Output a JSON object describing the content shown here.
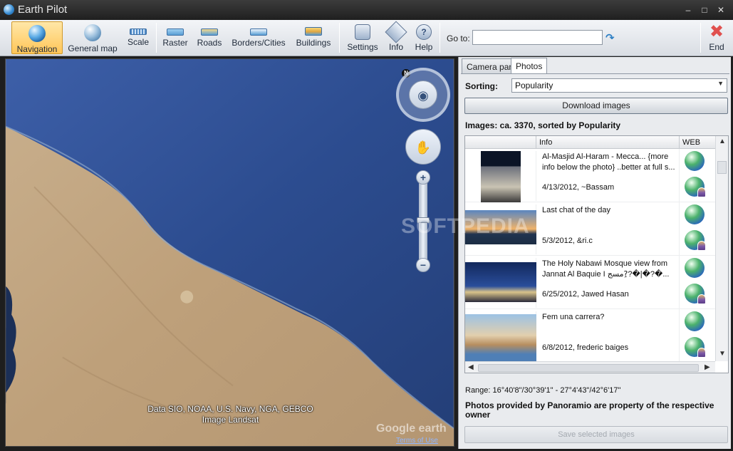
{
  "app": {
    "title": "Earth Pilot",
    "window_controls": {
      "minimize": "–",
      "maximize": "□",
      "close": "✕"
    }
  },
  "toolbar": {
    "buttons": [
      {
        "label": "Navigation",
        "icon": "globe-navigation-icon",
        "active": true
      },
      {
        "label": "General map",
        "icon": "general-map-icon"
      },
      {
        "label": "Scale",
        "icon": "ruler-icon"
      },
      {
        "label": "Raster",
        "icon": "raster-icon"
      },
      {
        "label": "Roads",
        "icon": "roads-icon"
      },
      {
        "label": "Borders/Cities",
        "icon": "borders-cities-icon"
      },
      {
        "label": "Buildings",
        "icon": "buildings-icon"
      },
      {
        "label": "Settings",
        "icon": "settings-icon"
      },
      {
        "label": "Info",
        "icon": "info-icon"
      },
      {
        "label": "Help",
        "icon": "help-icon"
      }
    ],
    "goto_label": "Go to:",
    "goto_value": "",
    "end_label": "End"
  },
  "map": {
    "copyright_line1": "Data SIO, NOAA, U.S. Navy, NGA, GEBCO",
    "copyright_line2": "Image Landsat",
    "google_logo": "Google earth",
    "terms": "Terms of Use",
    "north": "N",
    "zoom_in": "+",
    "zoom_out": "−"
  },
  "panel": {
    "tabs": [
      {
        "label": "Camera pan",
        "selected": false
      },
      {
        "label": "Photos",
        "selected": true
      }
    ],
    "sorting_label": "Sorting:",
    "sorting_value": "Popularity",
    "download_button": "Download images",
    "images_count_line": "Images: ca. 3370, sorted by Popularity",
    "grid": {
      "columns": {
        "info": "Info",
        "web": "WEB"
      },
      "rows": [
        {
          "title": "Al-Masjid Al-Haram - Mecca...  {more info below the photo}   ..better at full s...",
          "meta": "4/13/2012, ~Bassam"
        },
        {
          "title": "Last chat of the day",
          "meta": "5/3/2012, &ri.c"
        },
        {
          "title": "The Holy Nabawi Mosque  view from Jannat Al Baquie I مسج?ِ?�|�?�...",
          "meta": "6/25/2012, Jawed Hasan"
        },
        {
          "title": "Fem una carrera?",
          "meta": "6/8/2012, frederic baiges"
        }
      ]
    },
    "range": "Range:  16°40'8\"/30°39'1\" - 27°4'43\"/42°6'17\"",
    "credit": "Photos provided by Panoramio are property of the respective owner",
    "save_button": "Save selected images"
  },
  "watermark": "SOFTPEDIA"
}
